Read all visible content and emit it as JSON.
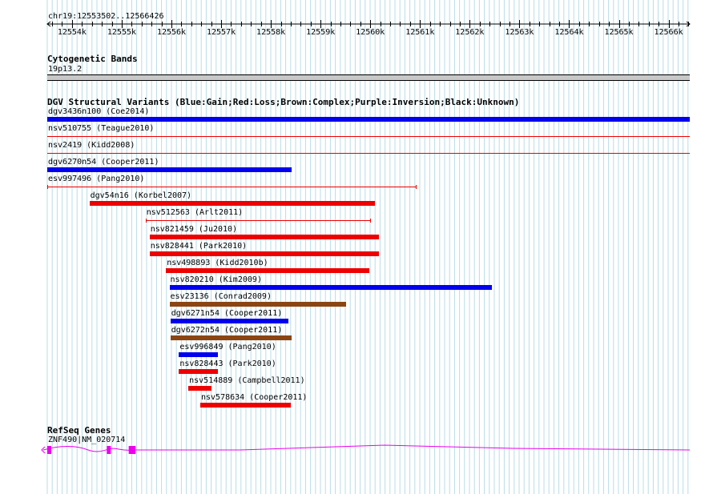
{
  "ruler": {
    "position_label": "chr19:12553502..12566426",
    "ticks": [
      "12554k",
      "12555k",
      "12556k",
      "12557k",
      "12558k",
      "12559k",
      "12560k",
      "12561k",
      "12562k",
      "12563k",
      "12564k",
      "12565k",
      "12566k"
    ]
  },
  "cytoband": {
    "title": "Cytogenetic Bands",
    "band": "19p13.2"
  },
  "dgv": {
    "title": "DGV Structural Variants (Blue:Gain;Red:Loss;Brown:Complex;Purple:Inversion;Black:Unknown)",
    "colors": {
      "gain": "#0000ee",
      "loss": "#ee0000",
      "complex": "#8b4513"
    },
    "variants": [
      {
        "label": "dgv3436n100 (Coe2014)",
        "type": "gain",
        "style": "bar",
        "start": 12553502,
        "end": 12566426
      },
      {
        "label": "nsv510755 (Teague2010)",
        "type": "loss",
        "style": "thin",
        "start": 12553502,
        "end": 12566426
      },
      {
        "label": "nsv2419 (Kidd2008)",
        "type": "loss",
        "style": "thin",
        "start": 12553502,
        "end": 12566426
      },
      {
        "label": "dgv6270n54 (Cooper2011)",
        "type": "gain",
        "style": "bar",
        "start": 12553502,
        "end": 12558415
      },
      {
        "label": "esv997496 (Pang2010)",
        "type": "loss",
        "style": "thin",
        "start": 12553502,
        "end": 12560915
      },
      {
        "label": "dgv54n16 (Korbel2007)",
        "type": "loss",
        "style": "bar",
        "start": 12554350,
        "end": 12560090
      },
      {
        "label": "nsv512563 (Arlt2011)",
        "type": "loss",
        "style": "thin",
        "start": 12555480,
        "end": 12560000
      },
      {
        "label": "nsv821459 (Ju2010)",
        "type": "loss",
        "style": "bar",
        "start": 12555560,
        "end": 12560170
      },
      {
        "label": "nsv828441 (Park2010)",
        "type": "loss",
        "style": "bar",
        "start": 12555560,
        "end": 12560170
      },
      {
        "label": "nsv498893 (Kidd2010b)",
        "type": "loss",
        "style": "bar",
        "start": 12555890,
        "end": 12559980
      },
      {
        "label": "nsv820210 (Kim2009)",
        "type": "gain",
        "style": "bar",
        "start": 12555960,
        "end": 12562440
      },
      {
        "label": "esv23136 (Conrad2009)",
        "type": "complex",
        "style": "bar",
        "start": 12555960,
        "end": 12559510
      },
      {
        "label": "dgv6271n54 (Cooper2011)",
        "type": "gain",
        "style": "bar",
        "start": 12555980,
        "end": 12558360
      },
      {
        "label": "dgv6272n54 (Cooper2011)",
        "type": "complex",
        "style": "bar",
        "start": 12555980,
        "end": 12558420
      },
      {
        "label": "esv996849 (Pang2010)",
        "type": "gain",
        "style": "bar",
        "start": 12556150,
        "end": 12556940
      },
      {
        "label": "nsv828443 (Park2010)",
        "type": "loss",
        "style": "bar",
        "start": 12556150,
        "end": 12556940
      },
      {
        "label": "nsv514889 (Campbell2011)",
        "type": "loss",
        "style": "bar",
        "start": 12556340,
        "end": 12556800
      },
      {
        "label": "nsv578634 (Cooper2011)",
        "type": "loss",
        "style": "bar",
        "start": 12556580,
        "end": 12558400
      }
    ]
  },
  "refseq": {
    "title": "RefSeq Genes",
    "gene_label": "ZNF490|NM_020714",
    "color": "#ee00ee",
    "start": 12553502,
    "end": 12566426,
    "exons": [
      {
        "start": 12553502,
        "end": 12553580
      },
      {
        "start": 12554700,
        "end": 12554780
      },
      {
        "start": 12555140,
        "end": 12555280
      }
    ]
  }
}
